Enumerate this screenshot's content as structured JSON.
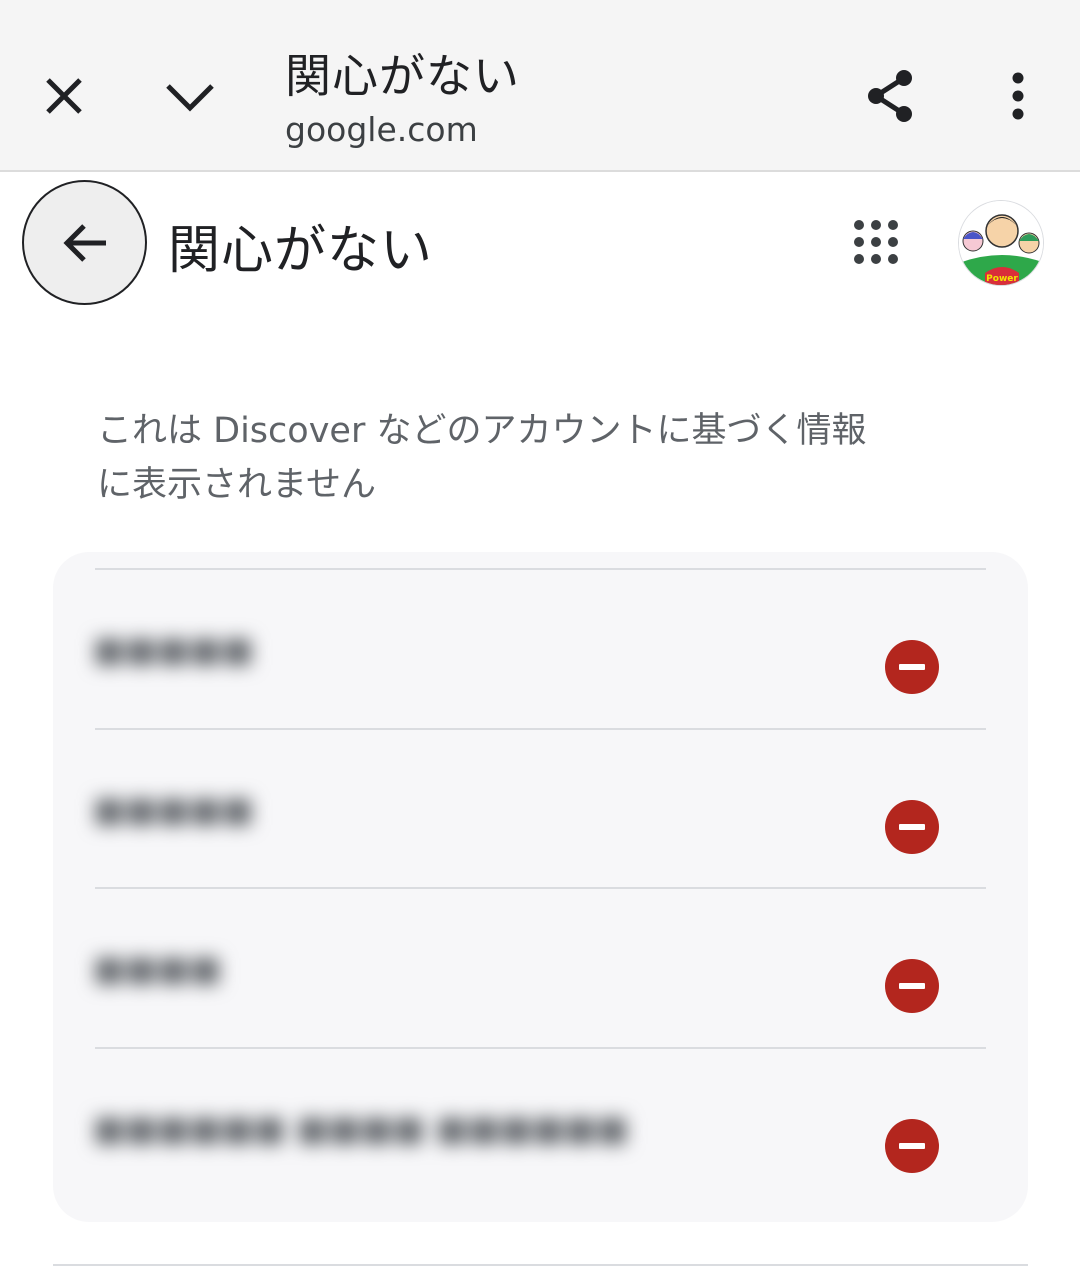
{
  "toolbar": {
    "title": "関心がない",
    "url": "google.com",
    "close_icon": "close-icon",
    "minimize_icon": "chevron-down-icon",
    "share_icon": "share-icon",
    "more_icon": "more-vert-icon"
  },
  "header": {
    "back_icon": "arrow-back-icon",
    "title": "関心がない",
    "apps_icon": "apps-grid-icon",
    "avatar_badge": "Power"
  },
  "description": "これは Discover などのアカウントに基づく情報に表示されません",
  "items": [
    {
      "label": "■■■■■",
      "remove_icon": "remove-circle-icon"
    },
    {
      "label": "■■■■■",
      "remove_icon": "remove-circle-icon"
    },
    {
      "label": "■■■■",
      "remove_icon": "remove-circle-icon"
    },
    {
      "label": "■■■■■■ ■■■■ ■■■■■■",
      "remove_icon": "remove-circle-icon"
    }
  ],
  "colors": {
    "toolbar_bg": "#f5f5f5",
    "card_bg": "#f7f7f9",
    "remove_red": "#b3261e",
    "text_primary": "#202124",
    "text_secondary": "#5f6368"
  }
}
